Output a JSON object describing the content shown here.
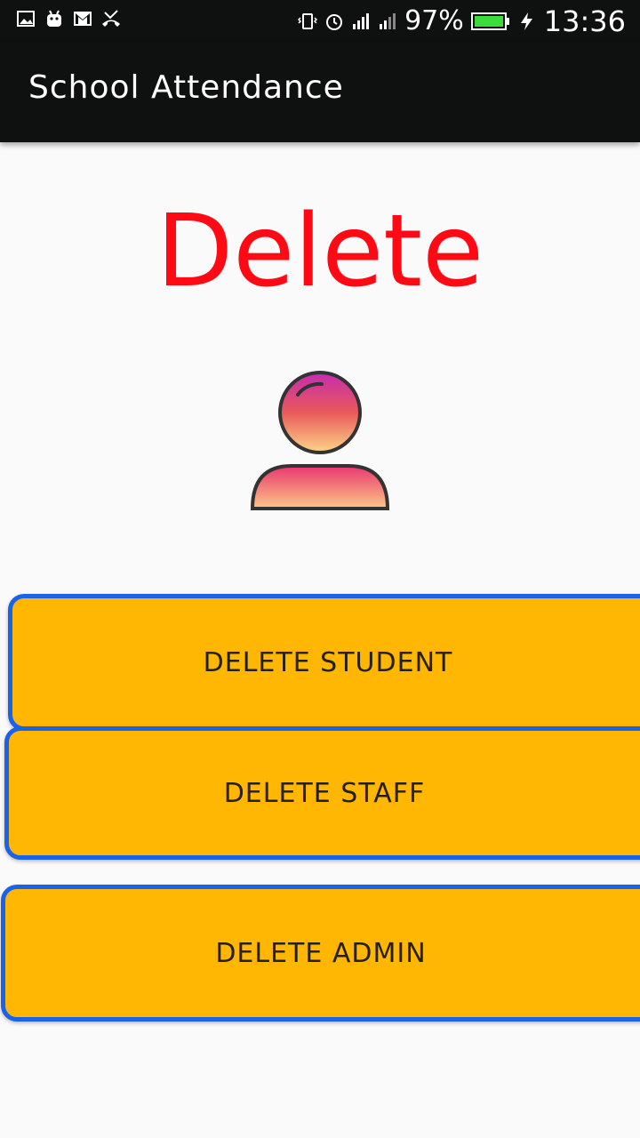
{
  "status_bar": {
    "battery_percent": "97%",
    "time": "13:36",
    "left_icons": [
      "gallery-icon",
      "android-icon",
      "gmail-icon",
      "missed-call-icon"
    ],
    "right_icons": [
      "vibrate-icon",
      "alarm-icon",
      "signal-sim1-icon",
      "signal-sim2-icon",
      "battery-icon",
      "charging-icon"
    ]
  },
  "app_bar": {
    "title": "School  Attendance"
  },
  "page": {
    "heading": "Delete"
  },
  "buttons": {
    "delete_student": "DELETE  STUDENT",
    "delete_staff": "DELETE  STAFF",
    "delete_admin": "DELETE  ADMIN"
  },
  "colors": {
    "heading": "#ff0a14",
    "button_fill": "#ffb703",
    "button_border": "#1a63e8",
    "app_bar": "#0f1010"
  }
}
